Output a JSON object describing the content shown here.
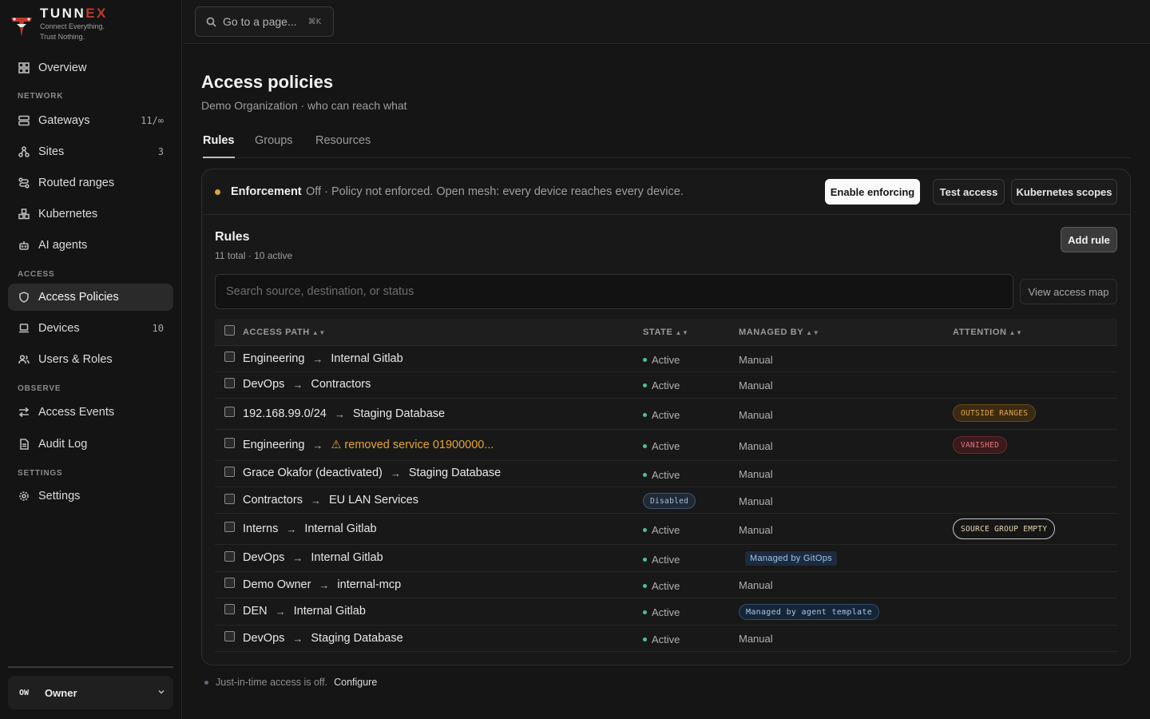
{
  "brand": {
    "name_main": "TUNN",
    "name_accent": "EX",
    "tagline_1": "Connect Everything.",
    "tagline_2": "Trust Nothing."
  },
  "sidebar": {
    "overview": "Overview",
    "sections": {
      "network": "NETWORK",
      "access": "ACCESS",
      "observe": "OBSERVE",
      "settings": "SETTINGS"
    },
    "items": {
      "gateways": {
        "label": "Gateways",
        "count": "11/∞"
      },
      "sites": {
        "label": "Sites",
        "count": "3"
      },
      "routed": {
        "label": "Routed ranges"
      },
      "kubernetes": {
        "label": "Kubernetes"
      },
      "ai_agents": {
        "label": "AI agents"
      },
      "access_policies": {
        "label": "Access Policies"
      },
      "devices": {
        "label": "Devices",
        "count": "10"
      },
      "users_roles": {
        "label": "Users & Roles"
      },
      "access_events": {
        "label": "Access Events"
      },
      "audit_log": {
        "label": "Audit Log"
      },
      "settings": {
        "label": "Settings"
      }
    },
    "user": {
      "initials": "OW",
      "name": "Owner"
    }
  },
  "topbar": {
    "goto_placeholder": "Go to a page...",
    "goto_shortcut": "⌘K"
  },
  "page": {
    "title": "Access policies",
    "subtitle": "Demo Organization · who can reach what",
    "tabs": [
      "Rules",
      "Groups",
      "Resources"
    ]
  },
  "enforcement": {
    "label": "Enforcement",
    "text": "Off · Policy not enforced. Open mesh: every device reaches every device.",
    "enable_button": "Enable enforcing",
    "test_button": "Test access",
    "k8s_button": "Kubernetes scopes"
  },
  "rules": {
    "title": "Rules",
    "summary": "11 total · 10 active",
    "add_button": "Add rule",
    "search_placeholder": "Search source, destination, or status",
    "access_map_button": "View access map",
    "columns": {
      "path": "ACCESS PATH",
      "state": "STATE",
      "managed": "MANAGED BY",
      "attention": "ATTENTION"
    },
    "rows": [
      {
        "source": "Engineering",
        "dest": "Internal Gitlab",
        "state": "Active",
        "managed": "Manual",
        "attention": ""
      },
      {
        "source": "DevOps",
        "dest": "Contractors",
        "state": "Active",
        "managed": "Manual",
        "attention": ""
      },
      {
        "source": "192.168.99.0/24",
        "dest": "Staging Database",
        "state": "Active",
        "managed": "Manual",
        "attention": "OUTSIDE RANGES"
      },
      {
        "source": "Engineering",
        "dest": "⚠ removed service 01900000...",
        "state": "Active",
        "managed": "Manual",
        "attention": "VANISHED"
      },
      {
        "source": "Grace Okafor (deactivated)",
        "dest": "Staging Database",
        "state": "Active",
        "managed": "Manual",
        "attention": ""
      },
      {
        "source": "Contractors",
        "dest": "EU LAN Services",
        "state": "Disabled",
        "managed": "Manual",
        "attention": ""
      },
      {
        "source": "Interns",
        "dest": "Internal Gitlab",
        "state": "Active",
        "managed": "Manual",
        "attention": "SOURCE GROUP EMPTY"
      },
      {
        "source": "DevOps",
        "dest": "Internal Gitlab",
        "state": "Active",
        "managed": "Managed by GitOps",
        "attention": ""
      },
      {
        "source": "Demo Owner",
        "dest": "internal-mcp",
        "state": "Active",
        "managed": "Manual",
        "attention": ""
      },
      {
        "source": "DEN",
        "dest": "Internal Gitlab",
        "state": "Active",
        "managed": "Managed by agent template",
        "attention": ""
      },
      {
        "source": "DevOps",
        "dest": "Staging Database",
        "state": "Active",
        "managed": "Manual",
        "attention": ""
      }
    ]
  },
  "jit": {
    "text": "Just-in-time access is off.",
    "link": "Configure"
  },
  "colors": {
    "accent_red": "#c0392b",
    "warn": "#e3a531",
    "active": "#4cc38a"
  }
}
